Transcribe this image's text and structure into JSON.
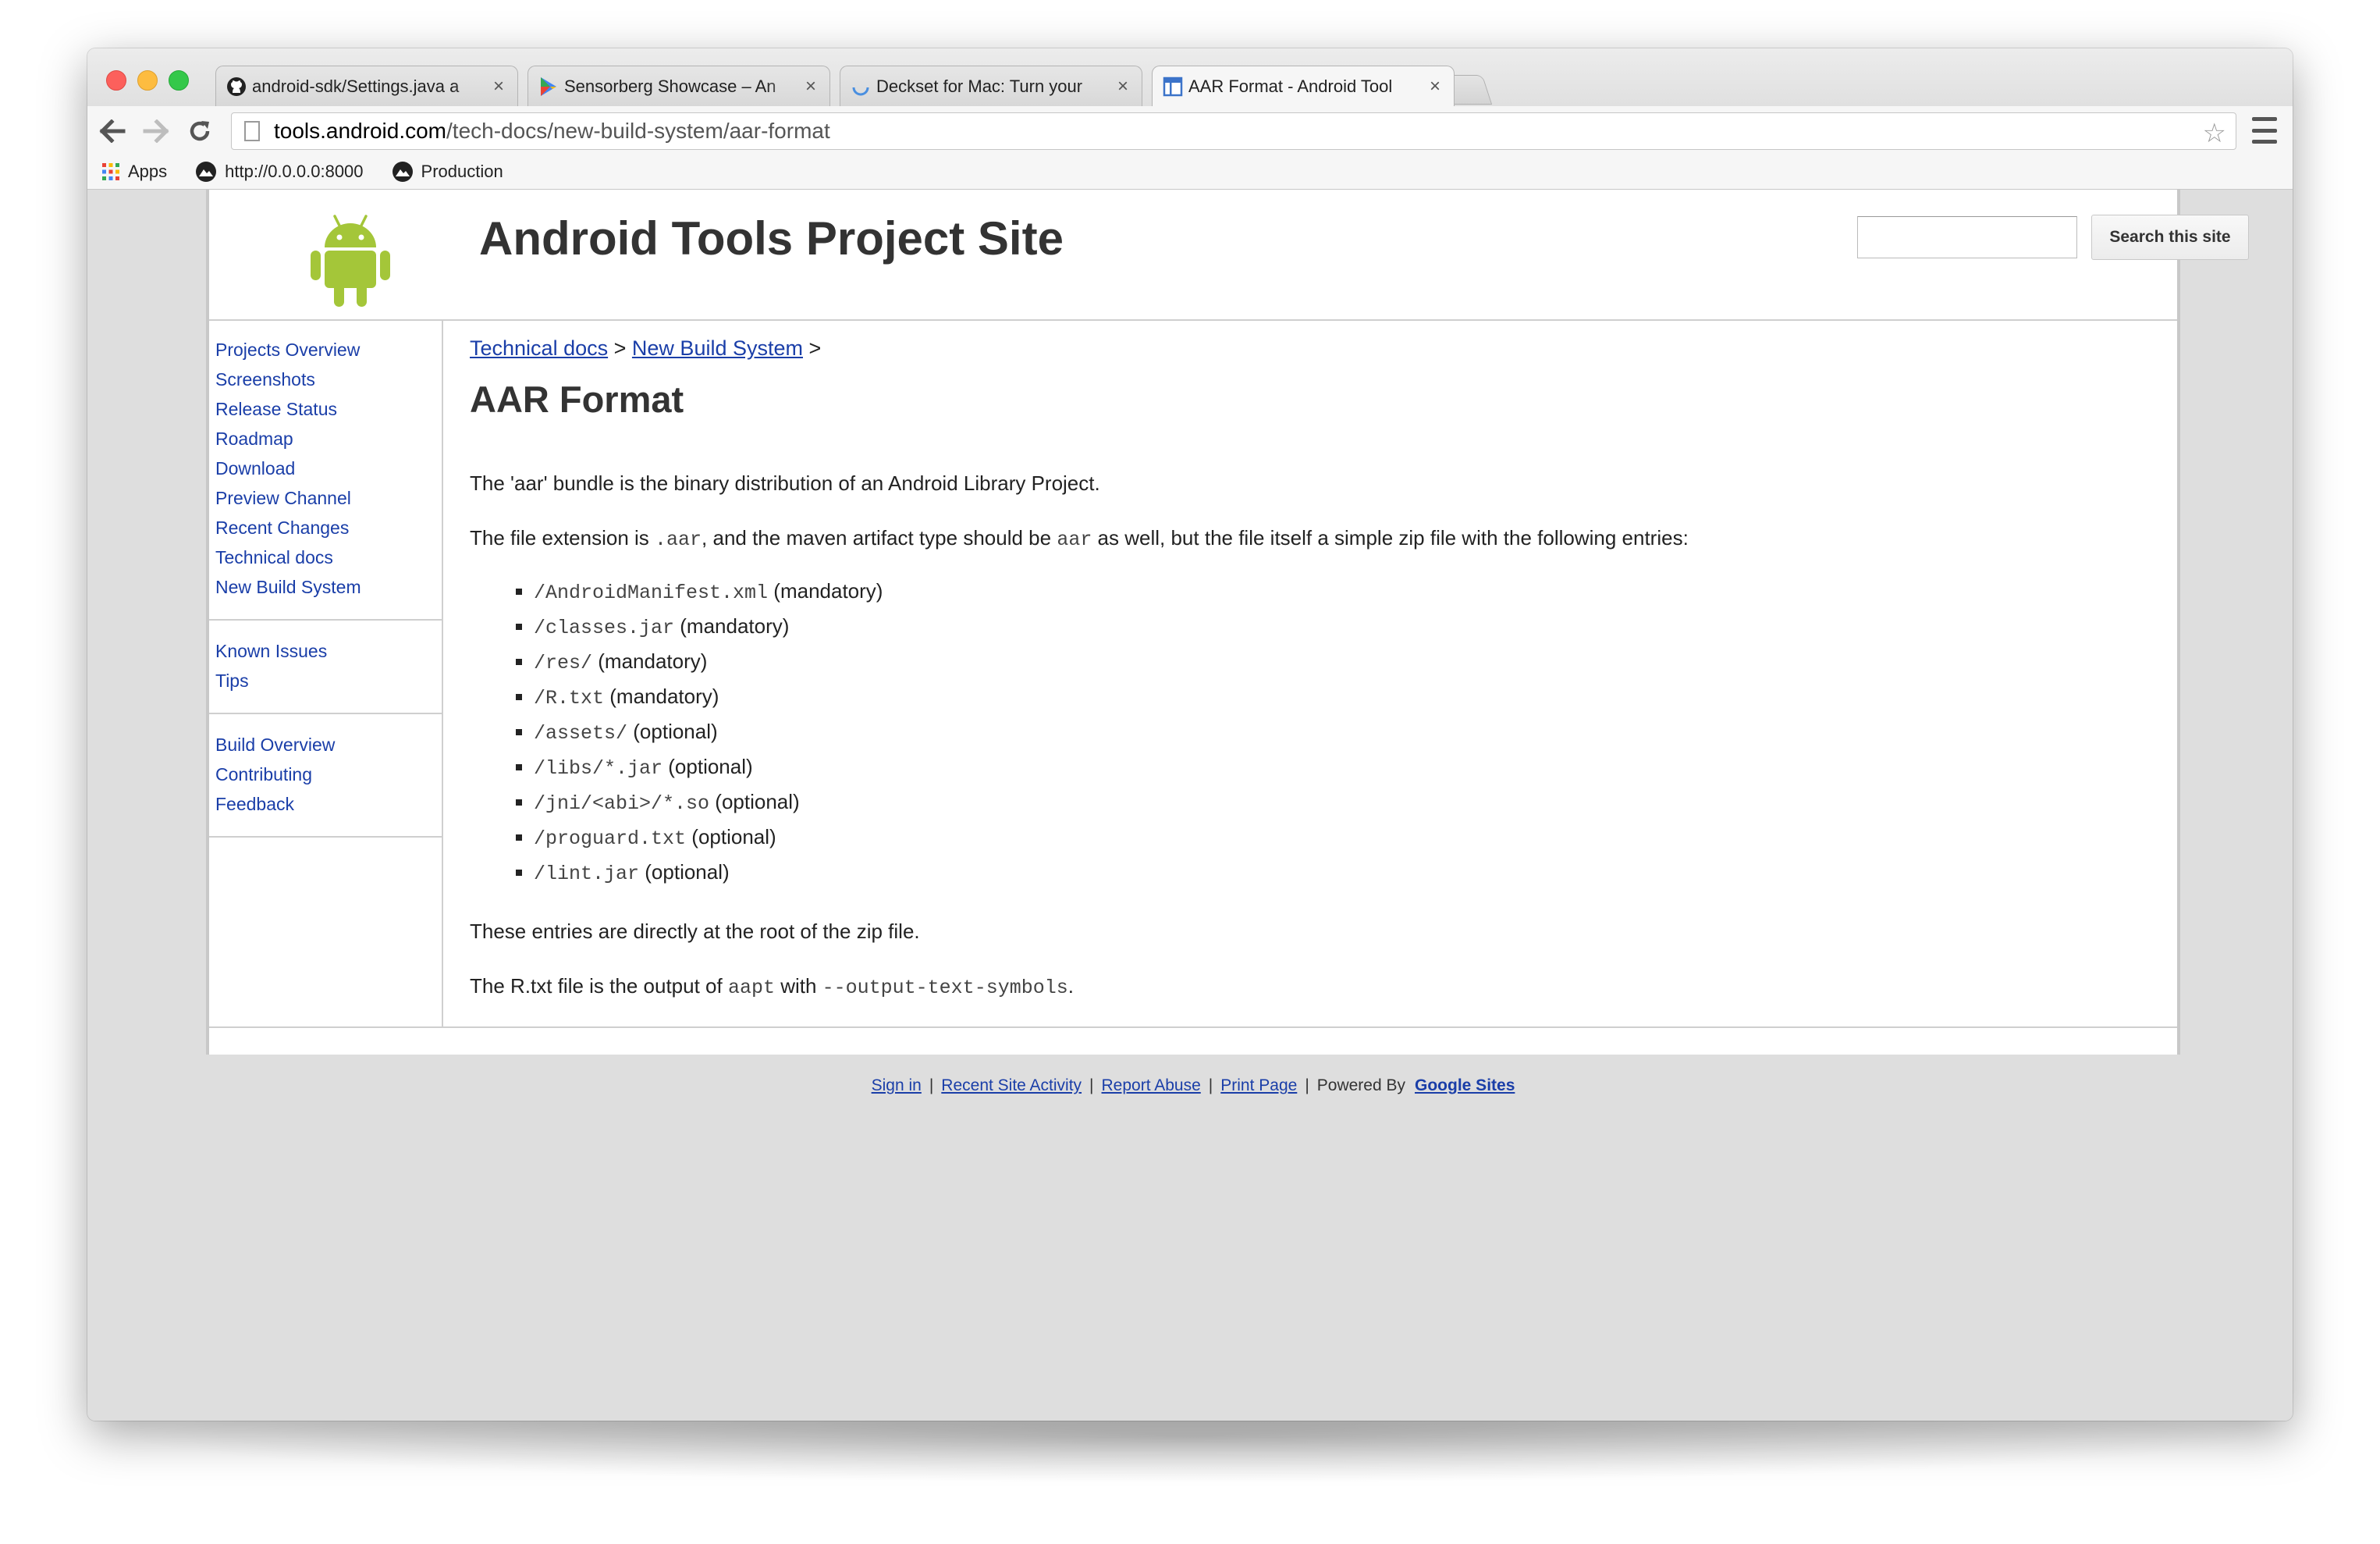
{
  "tabs": [
    {
      "title": "android-sdk/Settings.java a",
      "icon": "github-icon"
    },
    {
      "title": "Sensorberg Showcase – An",
      "icon": "play-store-icon"
    },
    {
      "title": "Deckset for Mac: Turn your",
      "icon": "loading-spinner-icon"
    },
    {
      "title": "AAR Format - Android Tool",
      "icon": "google-sites-icon"
    }
  ],
  "tab_close": "×",
  "omnibox": {
    "host": "tools.android.com",
    "path": "/tech-docs/new-build-system/aar-format"
  },
  "bookmarks": [
    {
      "label": "Apps",
      "icon": "apps-grid-icon"
    },
    {
      "label": "http://0.0.0.0:8000",
      "icon": "mountain-icon"
    },
    {
      "label": "Production",
      "icon": "mountain-icon"
    }
  ],
  "site": {
    "title": "Android Tools Project Site",
    "search_button": "Search this site",
    "search_value": ""
  },
  "sidebar": {
    "group1": [
      "Projects Overview",
      "Screenshots",
      "Release Status",
      "Roadmap",
      "Download",
      "Preview Channel",
      "Recent Changes",
      "Technical docs",
      "New Build System"
    ],
    "group2": [
      "Known Issues",
      "Tips"
    ],
    "group3": [
      "Build Overview",
      "Contributing",
      "Feedback"
    ]
  },
  "breadcrumb": {
    "item1": "Technical docs",
    "item2": "New Build System",
    "sep": ">"
  },
  "page_title": "AAR Format",
  "intro": "The 'aar' bundle is the binary distribution of an Android Library Project.",
  "extension_para": {
    "p1": "The file extension is ",
    "code1": ".aar",
    "p2": ", and the maven artifact type should be ",
    "code2": "aar",
    "p3": " as well, but the file itself a simple zip file with the following entries:"
  },
  "entries": [
    {
      "path": "/AndroidManifest.xml",
      "note": "(mandatory)"
    },
    {
      "path": "/classes.jar",
      "note": "(mandatory)"
    },
    {
      "path": "/res/",
      "note": "(mandatory)"
    },
    {
      "path": "/R.txt",
      "note": "(mandatory)"
    },
    {
      "path": "/assets/",
      "note": "(optional)"
    },
    {
      "path": "/libs/*.jar",
      "note": "(optional)"
    },
    {
      "path": "/jni/<abi>/*.so",
      "note": "(optional)"
    },
    {
      "path": "/proguard.txt",
      "note": " (optional)"
    },
    {
      "path": "/lint.jar",
      "note": "(optional)"
    }
  ],
  "root_para": "These entries are directly at the root of the zip file.",
  "rtxt_para": {
    "p1": "The R.txt file is the output of ",
    "code1": "aapt",
    "p2": " with ",
    "code2": "--output-text-symbols",
    "p3": "."
  },
  "footer": {
    "sign_in": "Sign in",
    "recent_activity": "Recent Site Activity",
    "report_abuse": "Report Abuse",
    "print_page": "Print Page",
    "separator": "|",
    "powered_by": "Powered By",
    "brand": "Google Sites"
  },
  "colors": {
    "link": "#1a3ea8",
    "android_green": "#a4c639"
  }
}
